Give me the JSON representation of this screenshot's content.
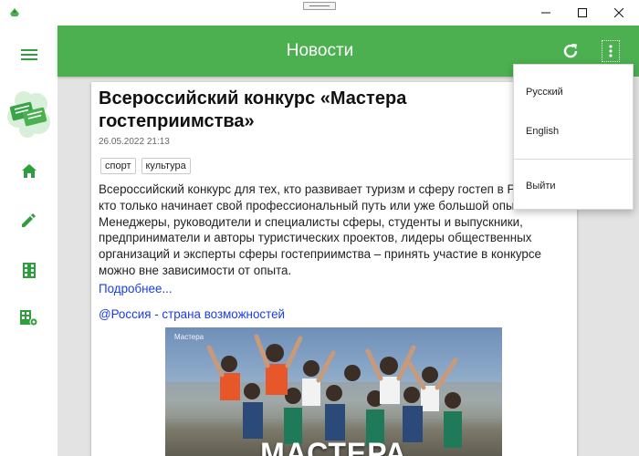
{
  "window": {
    "title": ""
  },
  "appbar": {
    "title": "Новости"
  },
  "sidebar": {
    "items": [
      {
        "icon": "menu-icon"
      },
      {
        "icon": "chat-bubbles-logo-icon"
      },
      {
        "icon": "home-icon"
      },
      {
        "icon": "pencil-icon"
      },
      {
        "icon": "building-icon"
      },
      {
        "icon": "building-settings-icon"
      }
    ]
  },
  "article": {
    "title": "Всероссийский конкурс «Мастера гостеприимства»",
    "date": "26.05.2022 21:13",
    "tags": [
      "спорт",
      "культура"
    ],
    "text": "Всероссийский конкурс для тех, кто развивает туризм и сферу гостеп в России, кто только начинает свой профессиональный путь или уже большой опыт. Менеджеры, руководители и специалисты сферы, студенты и выпускники, предприниматели и авторы туристических проектов, лидеры общественных организаций и эксперты сферы гостеприимства – принять участие в конкурсе можно вне зависимости от опыта.",
    "more_link": "Подробнее...",
    "source_link": "@Россия - страна возможностей",
    "image": {
      "logo_text": "Мастера",
      "caption": "МАСТЕРА"
    }
  },
  "menu": {
    "items": [
      "Русский",
      "English",
      "Выйти"
    ]
  },
  "colors": {
    "accent": "#4caf50",
    "link": "#1a3de8",
    "background": "#e3e3e3"
  }
}
